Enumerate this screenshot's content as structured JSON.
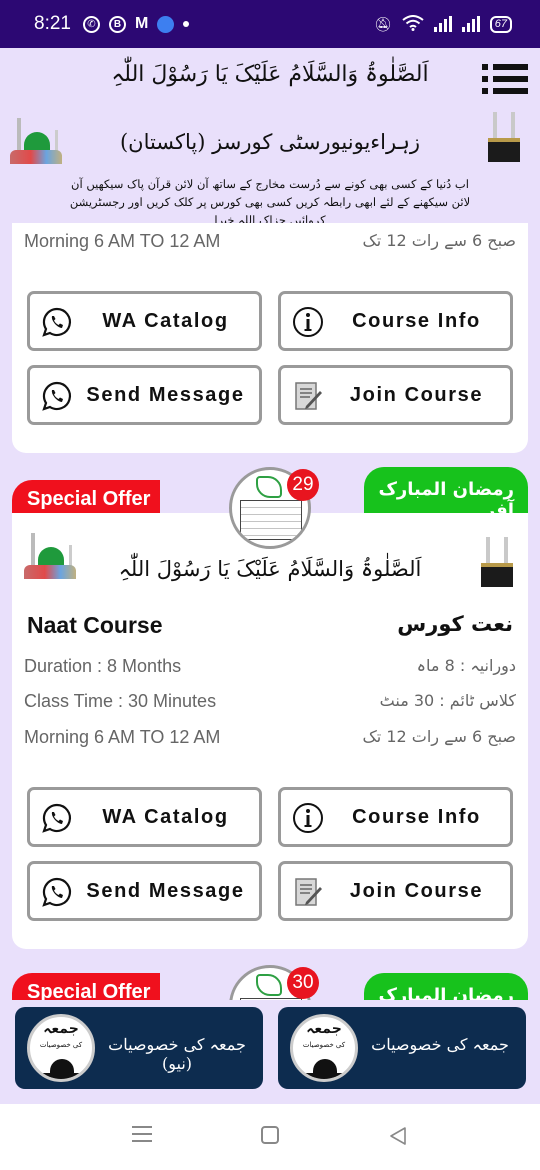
{
  "status_bar": {
    "time": "8:21",
    "battery": "67",
    "notification_icons": [
      "whatsapp-icon",
      "whatsapp-business-icon",
      "gmail-icon",
      "messenger-icon",
      "dot-icon"
    ],
    "system_icons": [
      "mute-icon",
      "wifi-icon",
      "signal-icon",
      "signal-icon",
      "battery-icon"
    ]
  },
  "header": {
    "salawat": "اَلصَّلٰوۃُ وَالسَّلَامُ عَلَیْکَ یَا رَسُوْلَ اللّٰہِ",
    "title": "زہراءیونیورسٹی کورسز (پاکستان)",
    "description": "اب دُنیا کے کسی بھی کونے سے دُرست مخارج کے ساتھ آن لائن قرآن پاک سیکھیں آن لائن سیکھنے کے لئے ابھی رابطہ کریں کسی بھی کورس پر کلک کریں اور رجسٹریشن کروائیں جزاک اللہ خیرا",
    "menu_icon": "hamburger-menu-icon"
  },
  "cards": [
    {
      "partial": true,
      "schedule_en": "Morning 6 AM TO 12 AM",
      "schedule_ur": "صبح 6 سے رات 12 تک",
      "buttons": {
        "wa_catalog": "WA Catalog",
        "course_info": "Course Info",
        "send_message": "Send Message",
        "join_course": "Join Course"
      }
    },
    {
      "ribbon_left": "Special Offer",
      "ribbon_right": "رمضان المبارک آفر",
      "badge": "29",
      "salawat": "اَلصَّلٰوۃُ وَالسَّلَامُ عَلَیْکَ یَا رَسُوْلَ اللّٰہِ",
      "title_en": "Naat Course",
      "title_ur": "نعت کورس",
      "duration_en": "Duration : 8 Months",
      "duration_ur": "دورانیہ : 8 ماہ",
      "class_time_en": "Class Time : 30 Minutes",
      "class_time_ur": "کلاس ٹائم : 30 منٹ",
      "schedule_en": "Morning 6 AM TO 12 AM",
      "schedule_ur": "صبح 6 سے رات 12 تک",
      "buttons": {
        "wa_catalog": "WA Catalog",
        "course_info": "Course Info",
        "send_message": "Send Message",
        "join_course": "Join Course"
      }
    },
    {
      "partial": true,
      "ribbon_left": "Special Offer",
      "ribbon_right": "رمضان المبارک آفر",
      "badge": "30"
    }
  ],
  "promos": [
    {
      "label": "جمعہ کی خصوصیات (نیو)",
      "icon_title": "جمعہ",
      "icon_subtitle": "کی خصوصیات"
    },
    {
      "label": "جمعہ کی خصوصیات",
      "icon_title": "جمعہ",
      "icon_subtitle": "کی خصوصیات"
    }
  ],
  "colors": {
    "status_bar": "#2c0873",
    "background": "#e9e0fb",
    "special_offer": "#f0101d",
    "ramadan_offer": "#17c21c",
    "promo_bg": "#0d2c4f",
    "badge": "#e8141f"
  }
}
